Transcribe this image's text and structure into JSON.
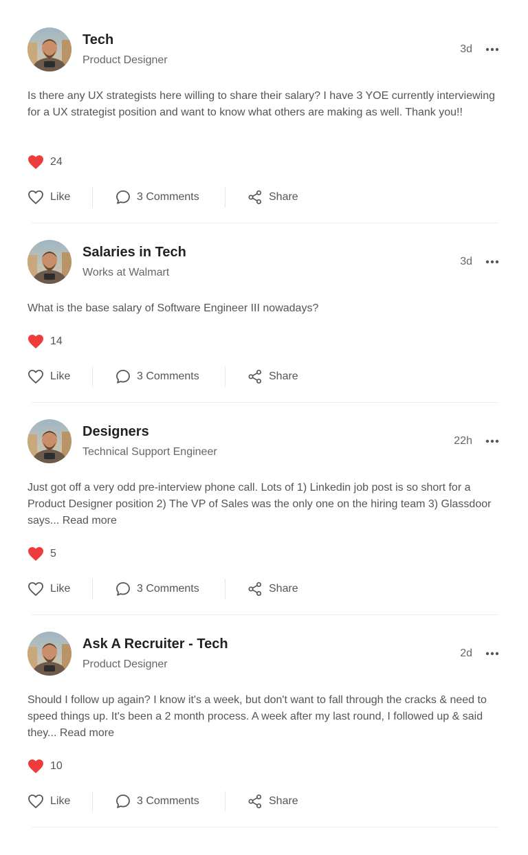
{
  "posts": [
    {
      "group": "Tech",
      "subtitle": "Product Designer",
      "time": "3d",
      "body": "Is there any UX strategists here willing to share their salary? I have 3 YOE currently interviewing for a UX strategist position and want to know what others are making as well. Thank you!!",
      "read_more": "",
      "likes": "24",
      "like_label": "Like",
      "comments_label": "3 Comments",
      "share_label": "Share"
    },
    {
      "group": "Salaries in Tech",
      "subtitle": "Works at Walmart",
      "time": "3d",
      "body": "What is the base salary of Software Engineer III nowadays?",
      "read_more": "",
      "likes": "14",
      "like_label": "Like",
      "comments_label": "3 Comments",
      "share_label": "Share"
    },
    {
      "group": "Designers",
      "subtitle": "Technical Support Engineer",
      "time": "22h",
      "body": "Just got off a very odd pre-interview phone call. Lots of 1) Linkedin job post is so short for a Product Designer position 2) The VP of Sales was the only one on the hiring team 3) Glassdoor says...",
      "read_more": "Read more",
      "likes": "5",
      "like_label": "Like",
      "comments_label": "3 Comments",
      "share_label": "Share"
    },
    {
      "group": "Ask A Recruiter - Tech",
      "subtitle": "Product Designer",
      "time": "2d",
      "body": "Should I follow up again? I know it's a week, but don't want to fall through the cracks & need to speed things up. It's been a 2 month process. A week after my last round, I followed up & said they...",
      "read_more": "Read more",
      "likes": "10",
      "like_label": "Like",
      "comments_label": "3 Comments",
      "share_label": "Share"
    }
  ],
  "icons": {
    "avatar": "avatar",
    "more": "more-horizontal-icon",
    "liked": "heart-filled-icon",
    "like": "heart-outline-icon",
    "comment": "comment-bubble-icon",
    "share": "share-icon"
  },
  "colors": {
    "heart": "#ee3b3b",
    "text_primary": "#222222",
    "text_secondary": "#666666",
    "icon": "#555555",
    "divider": "#ededed"
  }
}
